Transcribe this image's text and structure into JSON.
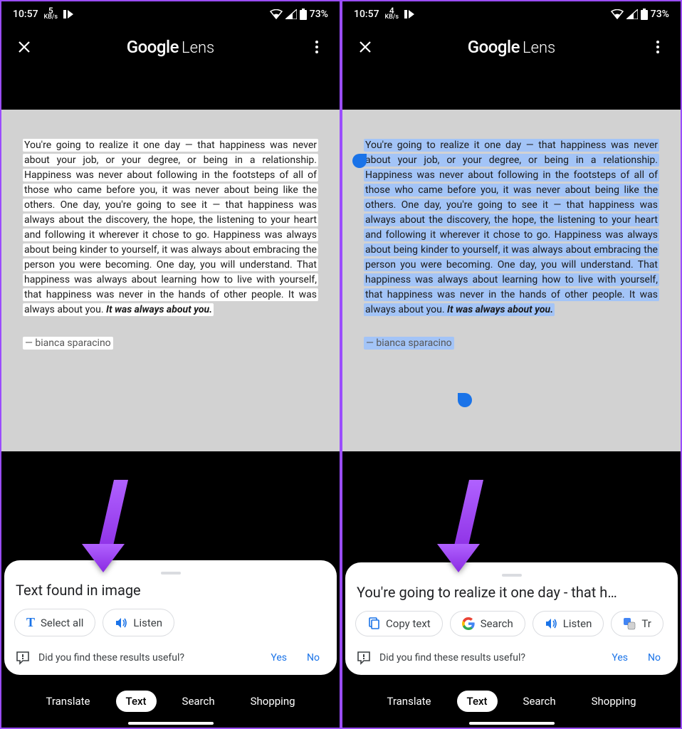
{
  "left": {
    "status": {
      "time": "10:57",
      "speed": "5",
      "speed_unit": "KB/s",
      "battery": "73%"
    },
    "header": {
      "brand": "Google",
      "sub": "Lens"
    },
    "quote": {
      "body": "You're going to realize it one day — that happiness was never about your job, or your degree, or being in a relationship. Happiness was never about following in the footsteps of all of those who came before you, it was never about being like the others. One day, you're going to see it — that happiness was always about the discovery, the hope, the listening to your heart and following it wherever it chose to go. Happiness was always about being kinder to yourself, it was always about embracing the person you were becoming. One day, you will understand. That happiness was always about learning how to live with yourself, that happiness was never in the hands of other people. It was always about you. ",
      "em": "It was always about you.",
      "author": "— bianca sparacino"
    },
    "sheet": {
      "title": "Text found in image",
      "chips": [
        {
          "icon": "T",
          "label": "Select all"
        },
        {
          "icon": "listen",
          "label": "Listen"
        }
      ],
      "feedback": {
        "prompt": "Did you find these results useful?",
        "yes": "Yes",
        "no": "No"
      }
    },
    "tabs": {
      "translate": "Translate",
      "text": "Text",
      "search": "Search",
      "shopping": "Shopping"
    }
  },
  "right": {
    "status": {
      "time": "10:57",
      "speed": "4",
      "speed_unit": "KB/s",
      "battery": "73%"
    },
    "header": {
      "brand": "Google",
      "sub": "Lens"
    },
    "quote": {
      "body": "You're going to realize it one day — that happiness was never about your job, or your degree, or being in a relationship. Happiness was never about following in the footsteps of all of those who came before you, it was never about being like the others. One day, you're going to see it — that happiness was always about the discovery, the hope, the listening to your heart and following it wherever it chose to go. Happiness was always about being kinder to yourself, it was always about embracing the person you were becoming. One day, you will understand. That happiness was always about learning how to live with yourself, that happiness was never in the hands of other people. It was always about you. ",
      "em": "It was always about you.",
      "author": "— bianca sparacino"
    },
    "sheet": {
      "title": "You're going to realize it one day - that h…",
      "chips": [
        {
          "icon": "copy",
          "label": "Copy text"
        },
        {
          "icon": "google",
          "label": "Search"
        },
        {
          "icon": "listen",
          "label": "Listen"
        },
        {
          "icon": "translate",
          "label": "Tr"
        }
      ],
      "feedback": {
        "prompt": "Did you find these results useful?",
        "yes": "Yes",
        "no": "No"
      }
    },
    "tabs": {
      "translate": "Translate",
      "text": "Text",
      "search": "Search",
      "shopping": "Shopping"
    }
  }
}
